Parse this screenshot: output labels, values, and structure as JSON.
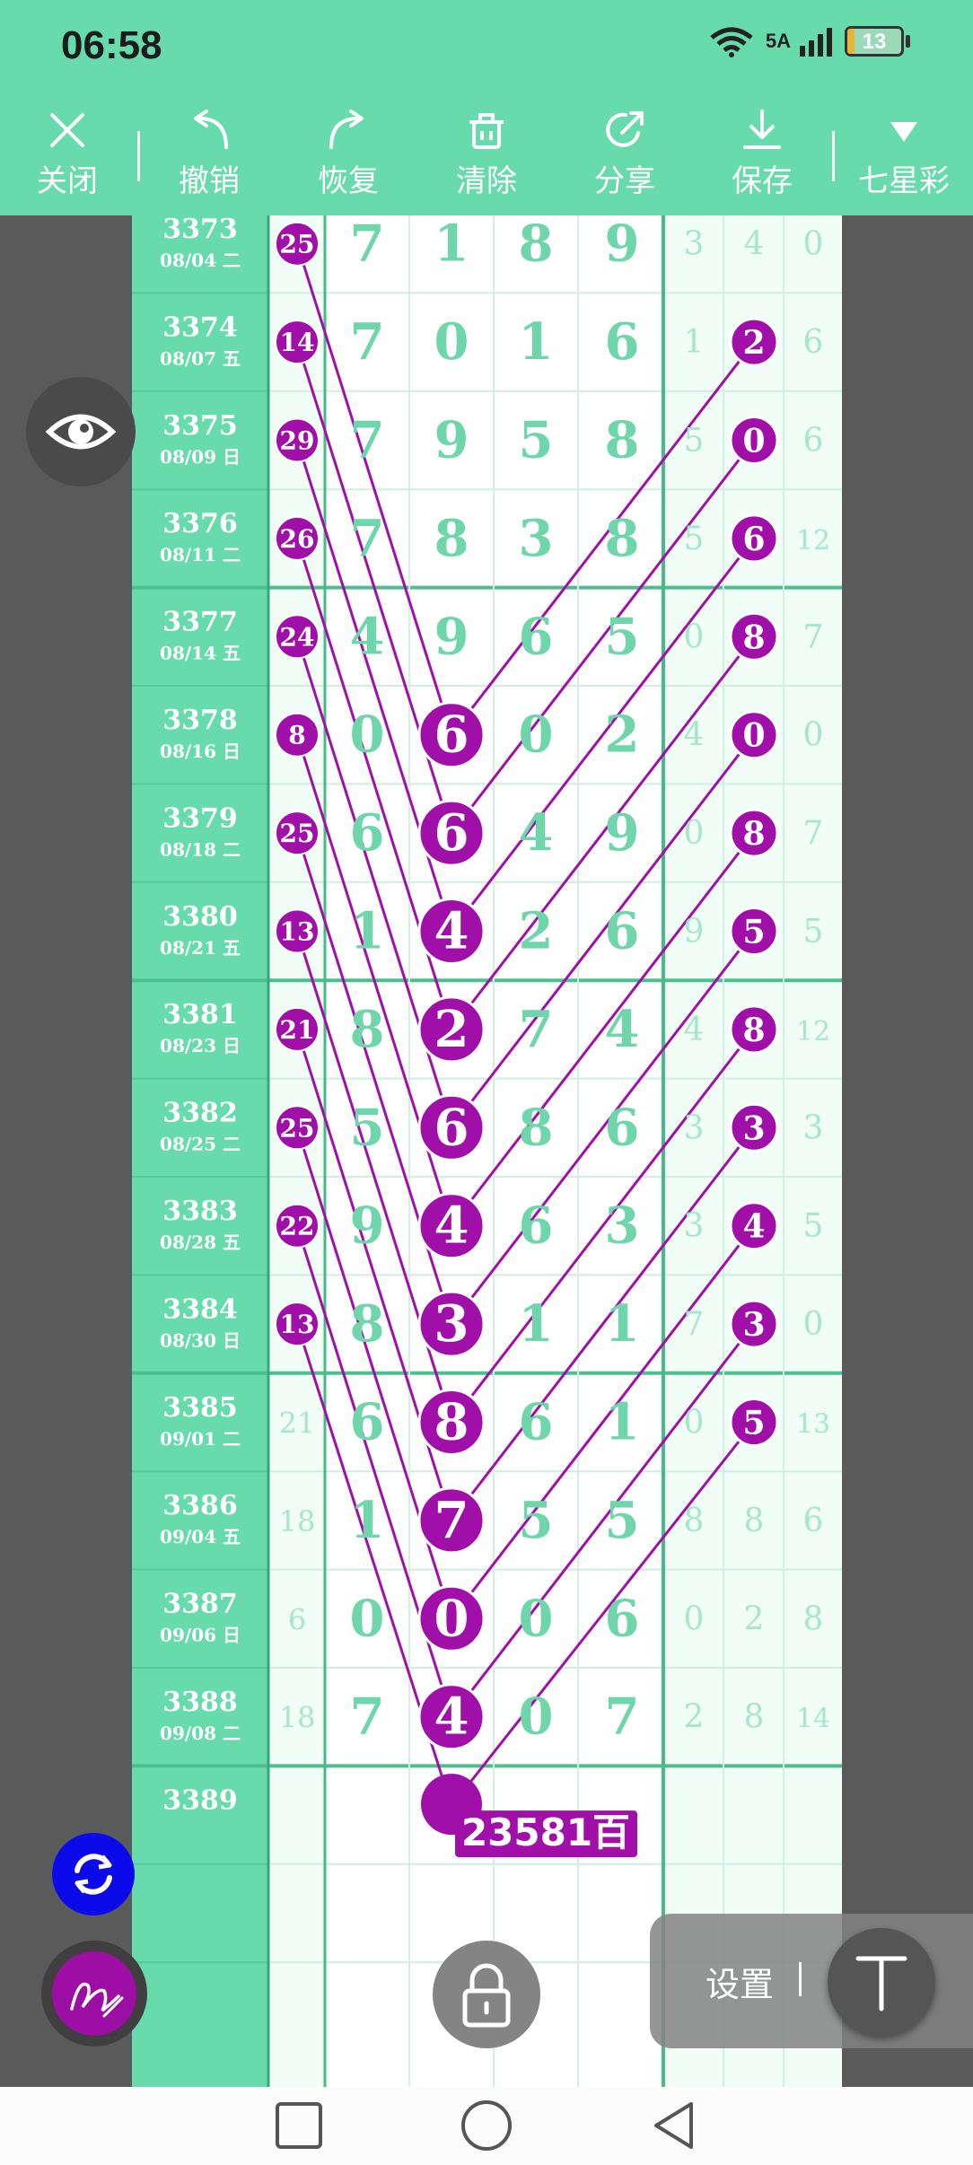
{
  "status_bar": {
    "time": "06:58",
    "network": "5A",
    "battery": "13",
    "battery_level": 0.13
  },
  "toolbar": {
    "items": [
      {
        "label": "关闭",
        "icon": "close-icon"
      },
      {
        "label": "撤销",
        "icon": "undo-icon"
      },
      {
        "label": "恢复",
        "icon": "redo-icon"
      },
      {
        "label": "清除",
        "icon": "clear-icon"
      },
      {
        "label": "分享",
        "icon": "share-icon"
      },
      {
        "label": "保存",
        "icon": "save-icon"
      },
      {
        "label": "七星彩",
        "icon": "dropdown-triangle-icon"
      }
    ]
  },
  "colors": {
    "accent": "#67dbac",
    "digit": "#6fd5ab",
    "marker": "#a010a8",
    "dark": "#5a5a5a"
  },
  "table": {
    "rows": [
      {
        "issue": "3373",
        "date": "08/04 二",
        "first": "25",
        "first_marked": true,
        "digits": [
          "7",
          "1",
          "8",
          "9"
        ],
        "extra": [
          "3",
          "4",
          "0"
        ],
        "marked_digit": null,
        "marked_extra": null
      },
      {
        "issue": "3374",
        "date": "08/07 五",
        "first": "14",
        "first_marked": true,
        "digits": [
          "7",
          "0",
          "1",
          "6"
        ],
        "extra": [
          "1",
          "2",
          "6"
        ],
        "marked_digit": null,
        "marked_extra": 1
      },
      {
        "issue": "3375",
        "date": "08/09 日",
        "first": "29",
        "first_marked": true,
        "digits": [
          "7",
          "9",
          "5",
          "8"
        ],
        "extra": [
          "5",
          "0",
          "6"
        ],
        "marked_digit": null,
        "marked_extra": 1
      },
      {
        "issue": "3376",
        "date": "08/11 二",
        "first": "26",
        "first_marked": true,
        "digits": [
          "7",
          "8",
          "3",
          "8"
        ],
        "extra": [
          "5",
          "6",
          "12"
        ],
        "marked_digit": null,
        "marked_extra": 1
      },
      {
        "issue": "3377",
        "date": "08/14 五",
        "first": "24",
        "first_marked": true,
        "digits": [
          "4",
          "9",
          "6",
          "5"
        ],
        "extra": [
          "0",
          "8",
          "7"
        ],
        "marked_digit": null,
        "marked_extra": 1
      },
      {
        "issue": "3378",
        "date": "08/16 日",
        "first": "8",
        "first_marked": true,
        "digits": [
          "0",
          "6",
          "0",
          "2"
        ],
        "extra": [
          "4",
          "0",
          "0"
        ],
        "marked_digit": 1,
        "marked_extra": 1
      },
      {
        "issue": "3379",
        "date": "08/18 二",
        "first": "25",
        "first_marked": true,
        "digits": [
          "6",
          "6",
          "4",
          "9"
        ],
        "extra": [
          "0",
          "8",
          "7"
        ],
        "marked_digit": 1,
        "marked_extra": 1
      },
      {
        "issue": "3380",
        "date": "08/21 五",
        "first": "13",
        "first_marked": true,
        "digits": [
          "1",
          "4",
          "2",
          "6"
        ],
        "extra": [
          "9",
          "5",
          "5"
        ],
        "marked_digit": 1,
        "marked_extra": 1
      },
      {
        "issue": "3381",
        "date": "08/23 日",
        "first": "21",
        "first_marked": true,
        "digits": [
          "8",
          "2",
          "7",
          "4"
        ],
        "extra": [
          "4",
          "8",
          "12"
        ],
        "marked_digit": 1,
        "marked_extra": 1
      },
      {
        "issue": "3382",
        "date": "08/25 二",
        "first": "25",
        "first_marked": true,
        "digits": [
          "5",
          "6",
          "8",
          "6"
        ],
        "extra": [
          "3",
          "3",
          "3"
        ],
        "marked_digit": 1,
        "marked_extra": 1
      },
      {
        "issue": "3383",
        "date": "08/28 五",
        "first": "22",
        "first_marked": true,
        "digits": [
          "9",
          "4",
          "6",
          "3"
        ],
        "extra": [
          "3",
          "4",
          "5"
        ],
        "marked_digit": 1,
        "marked_extra": 1
      },
      {
        "issue": "3384",
        "date": "08/30 日",
        "first": "13",
        "first_marked": true,
        "digits": [
          "8",
          "3",
          "1",
          "1"
        ],
        "extra": [
          "7",
          "3",
          "0"
        ],
        "marked_digit": 1,
        "marked_extra": 1
      },
      {
        "issue": "3385",
        "date": "09/01 二",
        "first": "21",
        "first_marked": false,
        "digits": [
          "6",
          "8",
          "6",
          "1"
        ],
        "extra": [
          "0",
          "5",
          "13"
        ],
        "marked_digit": 1,
        "marked_extra": 1
      },
      {
        "issue": "3386",
        "date": "09/04 五",
        "first": "18",
        "first_marked": false,
        "digits": [
          "1",
          "7",
          "5",
          "5"
        ],
        "extra": [
          "8",
          "8",
          "6"
        ],
        "marked_digit": 1,
        "marked_extra": null
      },
      {
        "issue": "3387",
        "date": "09/06 日",
        "first": "6",
        "first_marked": false,
        "digits": [
          "0",
          "0",
          "0",
          "6"
        ],
        "extra": [
          "0",
          "2",
          "8"
        ],
        "marked_digit": 1,
        "marked_extra": null
      },
      {
        "issue": "3388",
        "date": "09/08 二",
        "first": "18",
        "first_marked": false,
        "digits": [
          "7",
          "4",
          "0",
          "7"
        ],
        "extra": [
          "2",
          "8",
          "14"
        ],
        "marked_digit": 1,
        "marked_extra": null
      },
      {
        "issue": "3389",
        "date": "",
        "first": "",
        "first_marked": false,
        "digits": [
          "",
          "",
          "",
          ""
        ],
        "extra": [
          "",
          "",
          ""
        ],
        "marked_digit": null,
        "marked_extra": null
      }
    ],
    "prediction_label": "23581百"
  },
  "lines": [
    [
      "3373",
      "3378"
    ],
    [
      "3374",
      "3379"
    ],
    [
      "3375",
      "3380"
    ],
    [
      "3376",
      "3381"
    ],
    [
      "3377",
      "3382"
    ],
    [
      "3378",
      "3383"
    ],
    [
      "3379",
      "3384"
    ],
    [
      "3380",
      "3385"
    ],
    [
      "3381",
      "3386"
    ],
    [
      "3382",
      "3387"
    ],
    [
      "3383",
      "3388"
    ],
    [
      "3384",
      "3389"
    ],
    [
      "3374x",
      "3378"
    ],
    [
      "3375x",
      "3379"
    ],
    [
      "3376x",
      "3380"
    ],
    [
      "3377x",
      "3381"
    ],
    [
      "3378x",
      "3382"
    ],
    [
      "3379x",
      "3383"
    ],
    [
      "3380x",
      "3384"
    ],
    [
      "3381x",
      "3385"
    ],
    [
      "3382x",
      "3386"
    ],
    [
      "3383x",
      "3387"
    ],
    [
      "3384x",
      "3388"
    ],
    [
      "3385x",
      "3389"
    ]
  ],
  "floating": {
    "settings_label": "设置"
  },
  "nav": {
    "icons": [
      "recents-square-icon",
      "home-circle-icon",
      "back-triangle-icon"
    ]
  }
}
